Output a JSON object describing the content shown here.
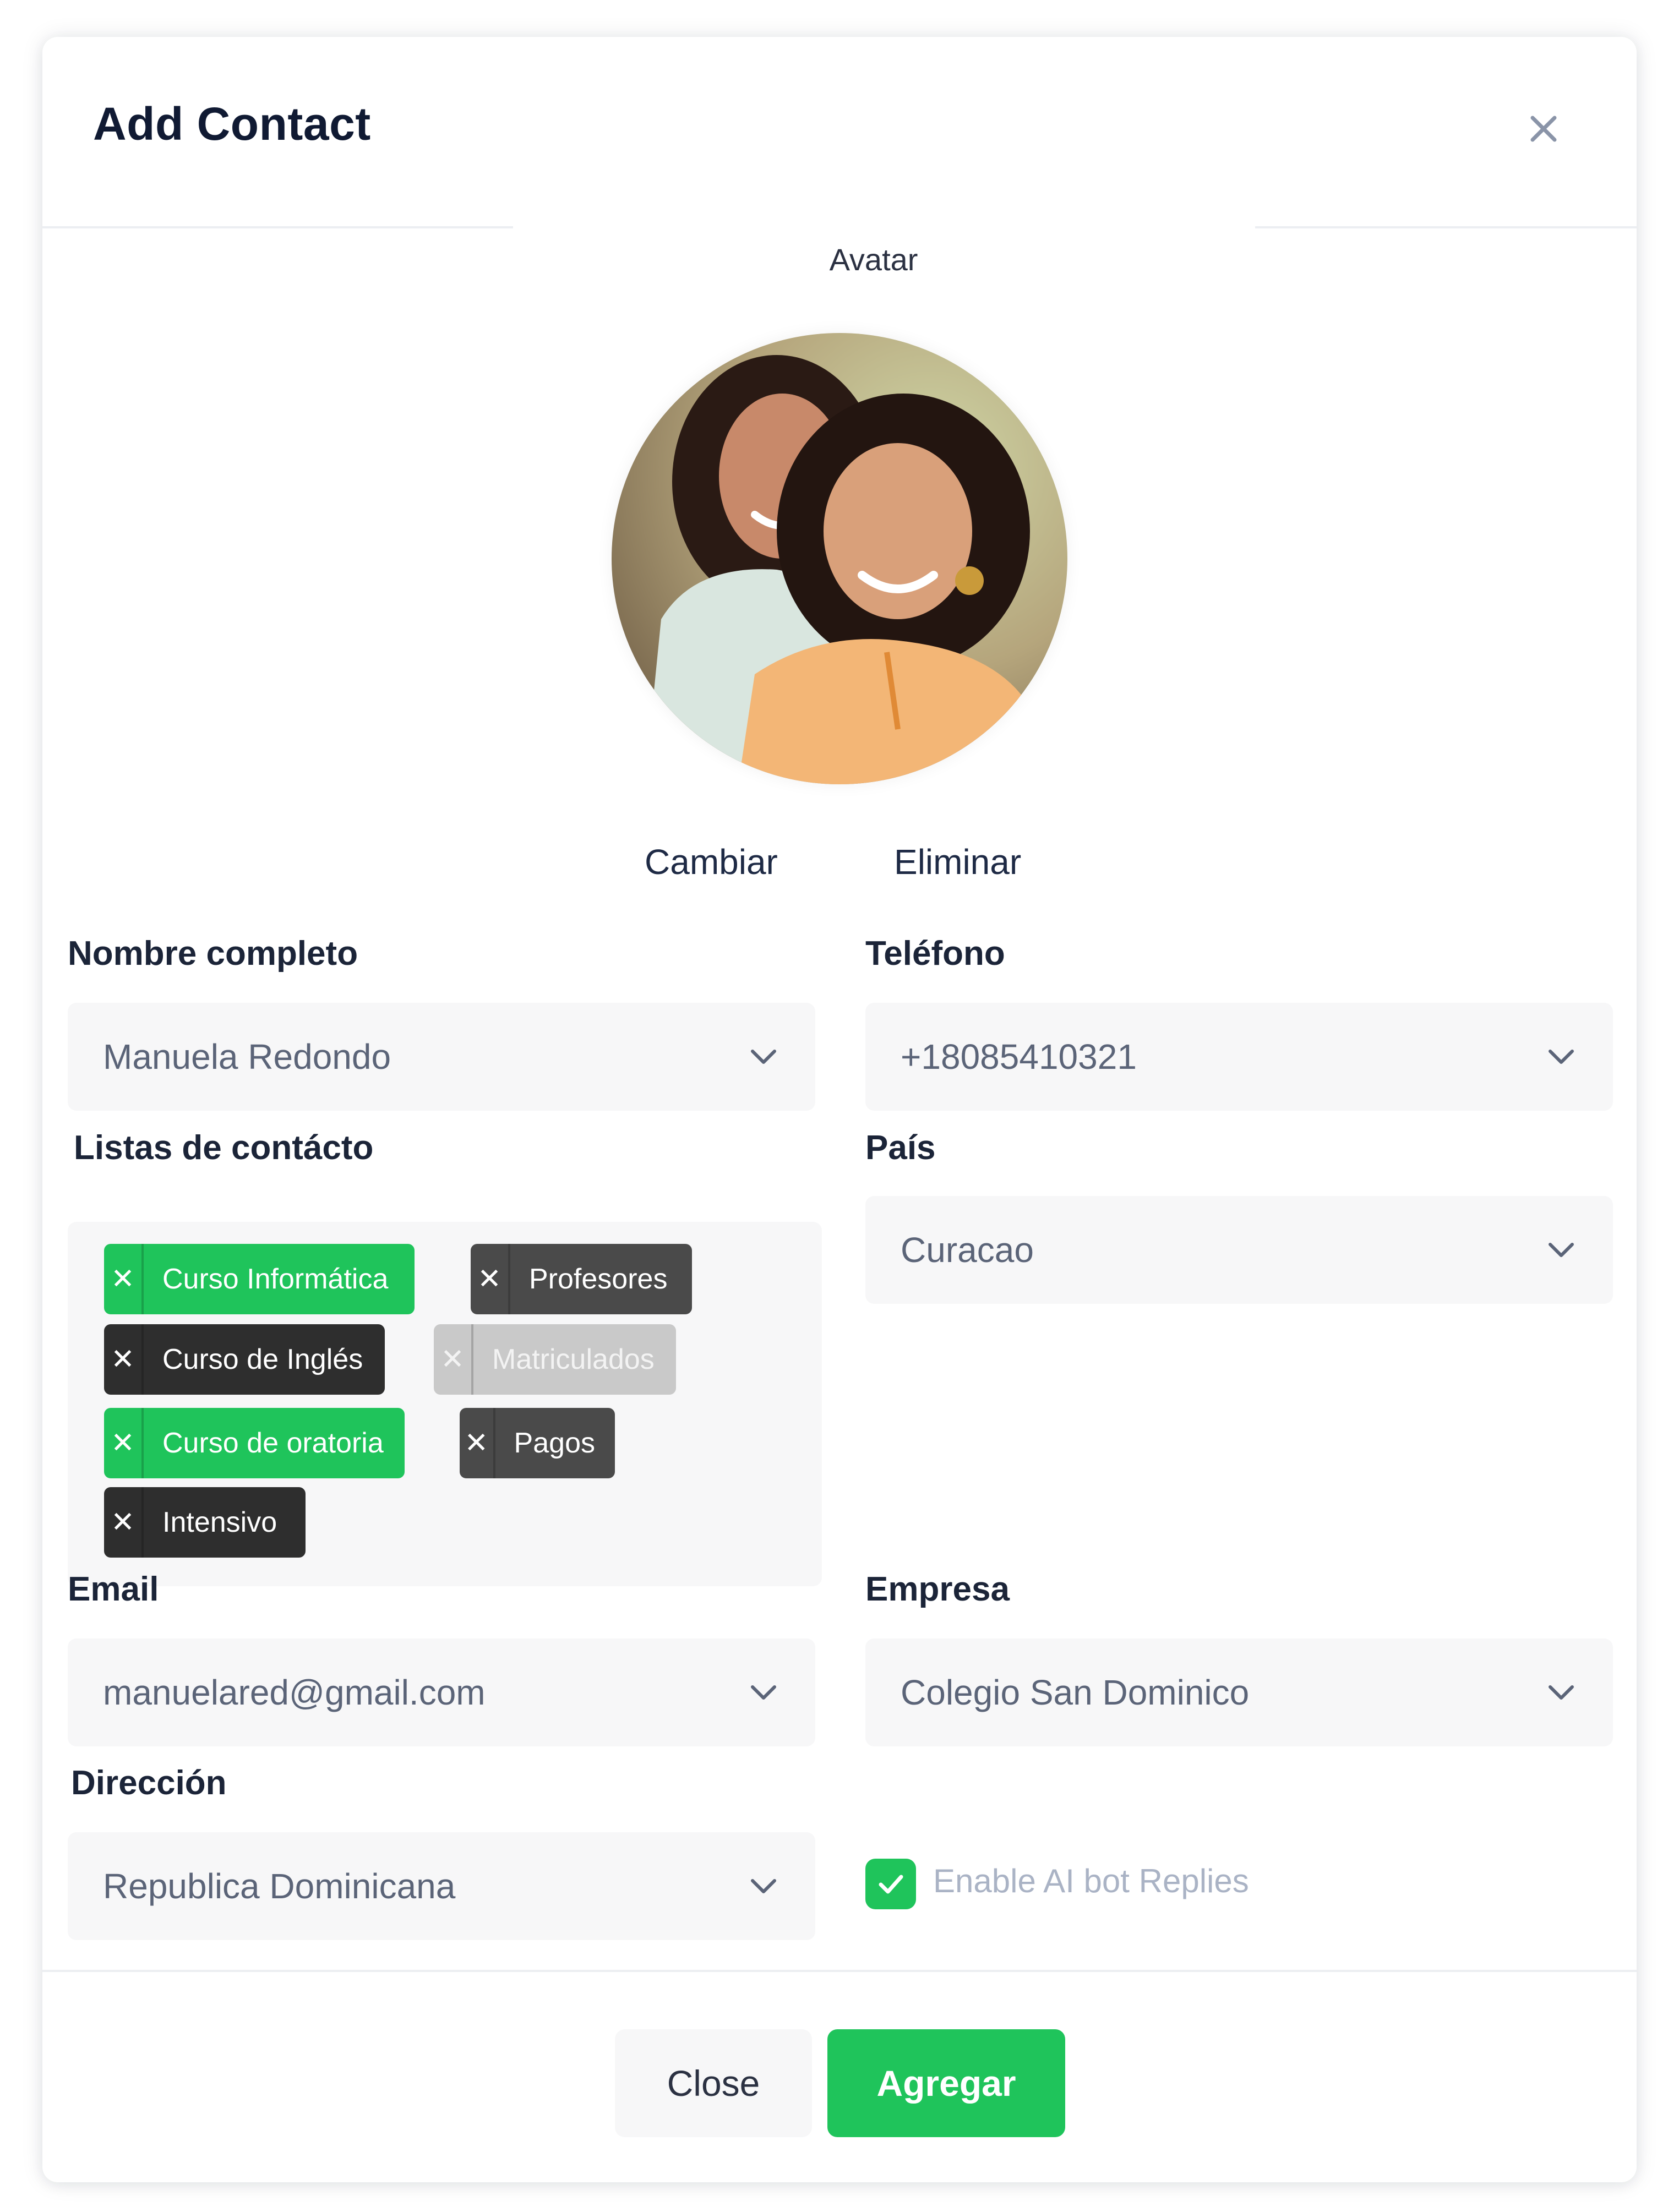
{
  "dialog": {
    "title": "Add Contact",
    "close_icon": "close-icon"
  },
  "avatar": {
    "label": "Avatar",
    "change_label": "Cambiar",
    "remove_label": "Eliminar"
  },
  "fields": {
    "full_name": {
      "label": "Nombre completo",
      "value": "Manuela Redondo"
    },
    "phone": {
      "label": "Teléfono",
      "value": "+18085410321"
    },
    "lists": {
      "label": "Listas de contácto"
    },
    "country": {
      "label": "País",
      "value": "Curacao"
    },
    "email": {
      "label": "Email",
      "value": "manuelared@gmail.com"
    },
    "company": {
      "label": "Empresa",
      "value": "Colegio San Dominico"
    },
    "address": {
      "label": "Dirección",
      "value": "Republica Dominicana"
    }
  },
  "tags": [
    {
      "label": "Curso Informática",
      "color": "#1fc45b"
    },
    {
      "label": "Profesores",
      "color": "#4a4a4a"
    },
    {
      "label": "Curso de Inglés",
      "color": "#2e2e2e"
    },
    {
      "label": "Matriculados",
      "color": "#c9c9c9"
    },
    {
      "label": "Curso de oratoria",
      "color": "#1fc45b"
    },
    {
      "label": "Pagos",
      "color": "#4a4a4a"
    },
    {
      "label": "Intensivo",
      "color": "#2e2e2e"
    }
  ],
  "ai_bot": {
    "label": "Enable AI bot Replies",
    "checked": true
  },
  "footer": {
    "close_label": "Close",
    "submit_label": "Agregar"
  },
  "colors": {
    "accent": "#1fc45b",
    "title": "#101a33",
    "field_bg": "#f7f7f8"
  }
}
